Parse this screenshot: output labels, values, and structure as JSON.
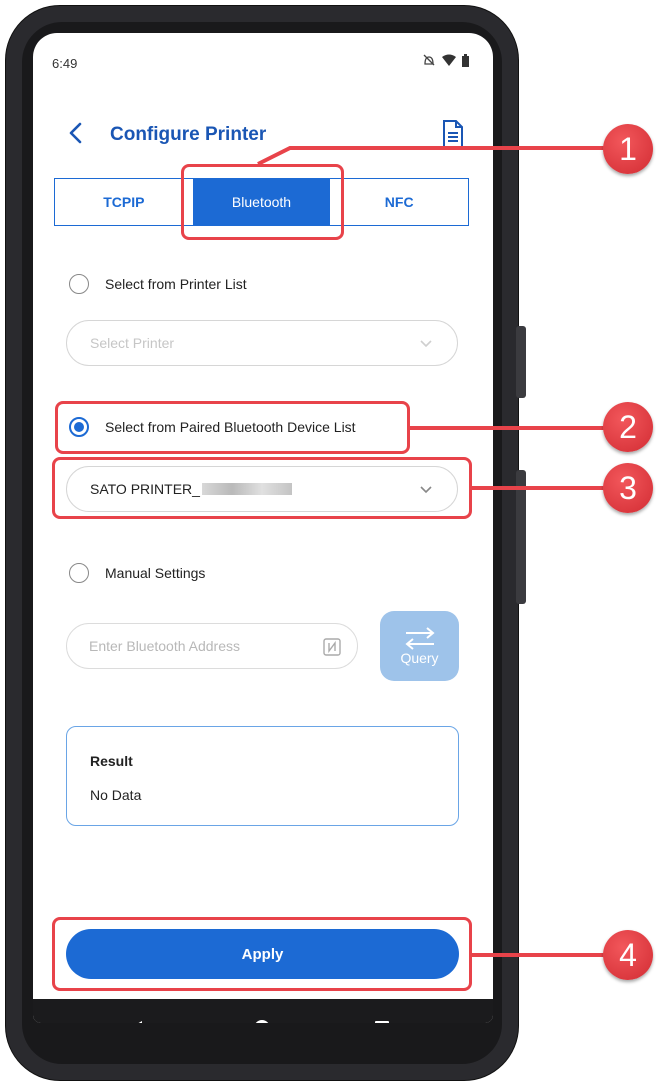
{
  "status_bar": {
    "time": "6:49"
  },
  "header": {
    "title": "Configure Printer"
  },
  "tabs": [
    {
      "label": "TCPIP",
      "active": false
    },
    {
      "label": "Bluetooth",
      "active": true
    },
    {
      "label": "NFC",
      "active": false
    }
  ],
  "options": {
    "printer_list_label": "Select from Printer List",
    "printer_select_placeholder": "Select Printer",
    "paired_list_label": "Select from Paired Bluetooth Device List",
    "paired_device_value": "SATO PRINTER_",
    "manual_label": "Manual Settings",
    "address_placeholder": "Enter Bluetooth Address",
    "query_label": "Query"
  },
  "result": {
    "title": "Result",
    "value": "No Data"
  },
  "apply_label": "Apply",
  "callouts": [
    "1",
    "2",
    "3",
    "4"
  ],
  "colors": {
    "primary": "#1c6ad4",
    "callout": "#e8434a",
    "query_disabled": "#9ec3ea"
  },
  "icons": [
    "back-arrow-icon",
    "document-icon",
    "chevron-down-icon",
    "nfc-icon",
    "swap-arrows-icon",
    "nav-back-icon",
    "nav-home-icon",
    "nav-recents-icon",
    "mute-icon",
    "wifi-icon",
    "battery-icon"
  ]
}
